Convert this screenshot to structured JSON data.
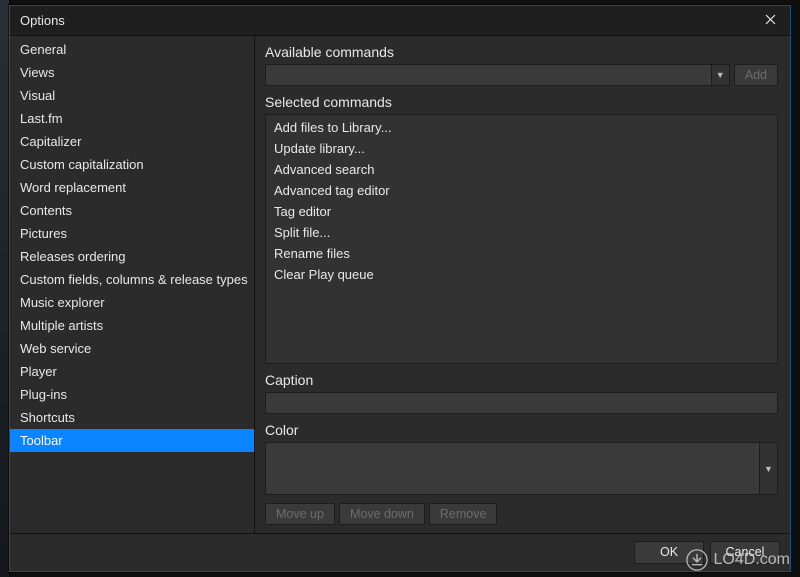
{
  "dialog": {
    "title": "Options"
  },
  "sidebar": {
    "selectedIndex": 17,
    "items": [
      "General",
      "Views",
      "Visual",
      "Last.fm",
      "Capitalizer",
      "Custom capitalization",
      "Word replacement",
      "Contents",
      "Pictures",
      "Releases ordering",
      "Custom fields, columns & release types",
      "Music explorer",
      "Multiple artists",
      "Web service",
      "Player",
      "Plug-ins",
      "Shortcuts",
      "Toolbar"
    ]
  },
  "main": {
    "available_label": "Available commands",
    "add_label": "Add",
    "selected_label": "Selected commands",
    "selected_commands": [
      "Add files to Library...",
      "Update library...",
      "Advanced search",
      "Advanced tag editor",
      "Tag editor",
      "Split file...",
      "Rename files",
      "Clear Play queue"
    ],
    "caption_label": "Caption",
    "caption_value": "",
    "color_label": "Color",
    "color_value": "",
    "moveup_label": "Move up",
    "movedown_label": "Move down",
    "remove_label": "Remove"
  },
  "footer": {
    "ok": "OK",
    "cancel": "Cancel"
  },
  "watermark": "LO4D.com"
}
